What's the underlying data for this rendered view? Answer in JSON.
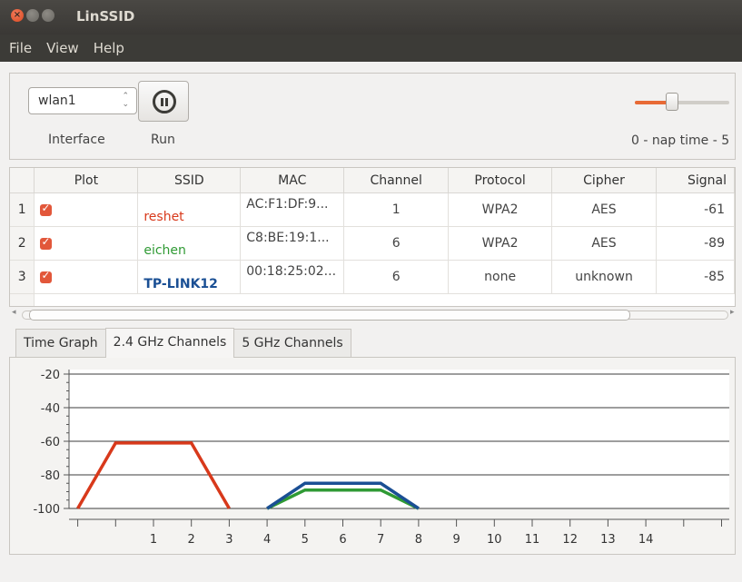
{
  "window": {
    "title": "LinSSID"
  },
  "menu": [
    "File",
    "View",
    "Help"
  ],
  "controls": {
    "interface_value": "wlan1",
    "interface_label": "Interface",
    "run_label": "Run",
    "nap_label": "0 - nap time - 5",
    "nap_time": 2,
    "nap_min": 0,
    "nap_max": 5
  },
  "table": {
    "headers": [
      "Plot",
      "SSID",
      "MAC",
      "Channel",
      "Protocol",
      "Cipher",
      "Signal"
    ],
    "rows": [
      {
        "num": "1",
        "plot": true,
        "ssid": "reshet",
        "mac": "AC:F1:DF:9...",
        "channel": "1",
        "protocol": "WPA2",
        "cipher": "AES",
        "signal": "-61",
        "color": "#d8391b"
      },
      {
        "num": "2",
        "plot": true,
        "ssid": "eichen",
        "mac": "C8:BE:19:1...",
        "channel": "6",
        "protocol": "WPA2",
        "cipher": "AES",
        "signal": "-89",
        "color": "#2f9a34"
      },
      {
        "num": "3",
        "plot": true,
        "ssid": "TP-LINK12",
        "mac": "00:18:25:02...",
        "channel": "6",
        "protocol": "none",
        "cipher": "unknown",
        "signal": "-85",
        "color": "#1a4f94"
      }
    ]
  },
  "tabs": [
    "Time Graph",
    "2.4 GHz Channels",
    "5 GHz Channels"
  ],
  "active_tab": 1,
  "chart_data": {
    "type": "line",
    "ylim": [
      -100,
      -20
    ],
    "yticks": [
      -20,
      -40,
      -60,
      -80,
      -100
    ],
    "xlim": [
      -1,
      16
    ],
    "xticks": [
      1,
      2,
      3,
      4,
      5,
      6,
      7,
      8,
      9,
      10,
      11,
      12,
      13,
      14
    ],
    "series": [
      {
        "color": "#d8391b",
        "x": [
          -1,
          0,
          2,
          3
        ],
        "y": [
          -100,
          -61,
          -61,
          -100
        ]
      },
      {
        "color": "#2f9a34",
        "x": [
          4,
          5,
          7,
          8
        ],
        "y": [
          -100,
          -89,
          -89,
          -100
        ]
      },
      {
        "color": "#1a4f94",
        "x": [
          4,
          5,
          7,
          8
        ],
        "y": [
          -100,
          -85,
          -85,
          -100
        ]
      }
    ]
  }
}
